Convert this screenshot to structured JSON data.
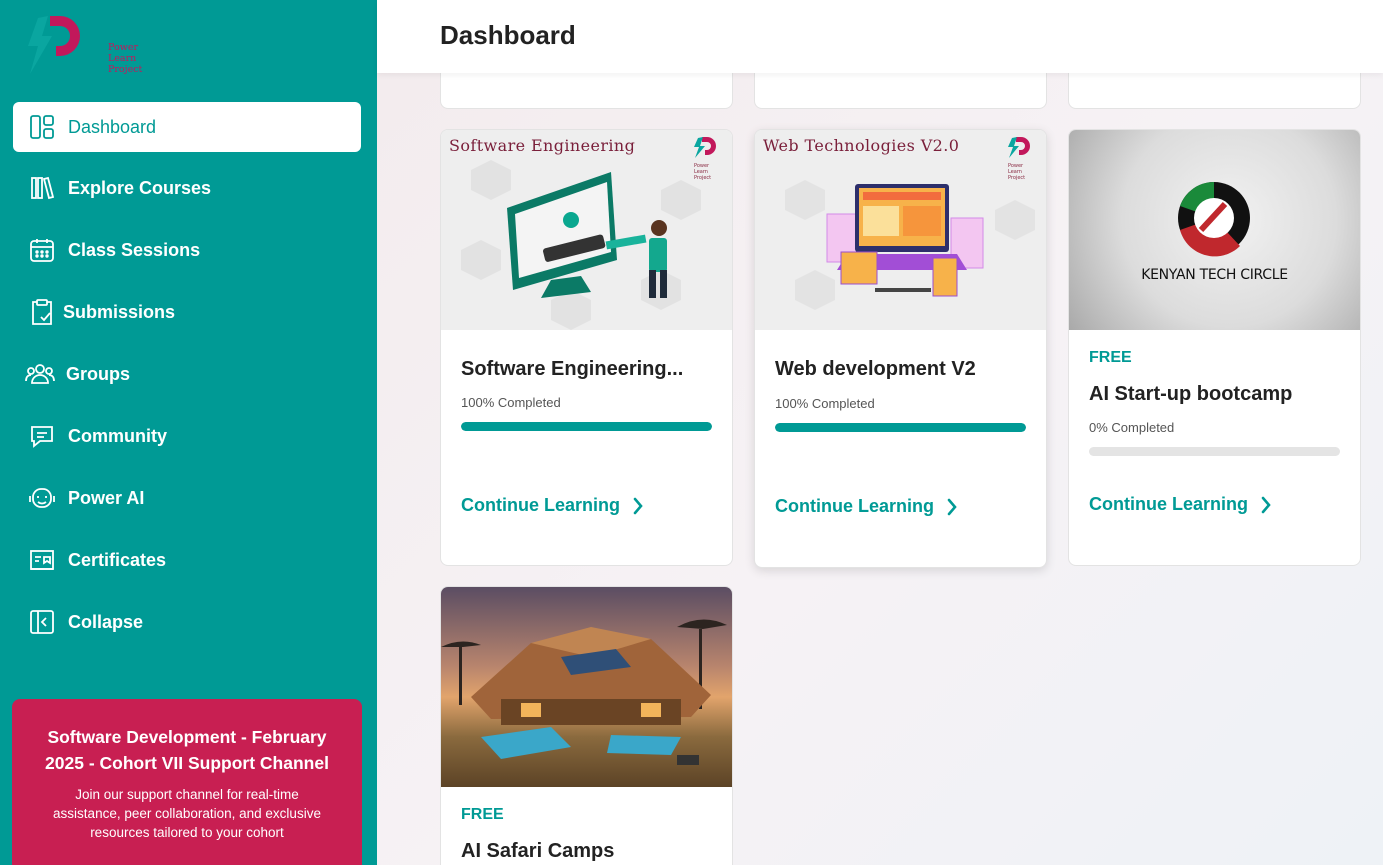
{
  "brand": {
    "logo_line1": "Power",
    "logo_line2": "Learn",
    "logo_line3": "Project"
  },
  "sidebar": {
    "items": [
      {
        "label": "Dashboard",
        "icon": "dashboard-icon",
        "active": true
      },
      {
        "label": "Explore Courses",
        "icon": "books-icon"
      },
      {
        "label": "Class Sessions",
        "icon": "calendar-icon"
      },
      {
        "label": "Submissions",
        "icon": "clipboard-check-icon"
      },
      {
        "label": "Groups",
        "icon": "users-icon"
      },
      {
        "label": "Community",
        "icon": "chat-icon"
      },
      {
        "label": "Power AI",
        "icon": "robot-icon"
      },
      {
        "label": "Certificates",
        "icon": "certificate-icon"
      },
      {
        "label": "Collapse",
        "icon": "collapse-icon"
      }
    ]
  },
  "support": {
    "title": "Software Development - February 2025 - Cohort VII Support Channel",
    "description": "Join our support channel for real-time assistance, peer collaboration, and exclusive resources tailored to your cohort"
  },
  "header": {
    "title": "Dashboard"
  },
  "courses": [
    {
      "title": "Software Engineering...",
      "thumb_title": "Software Engineering",
      "progress_label": "100% Completed",
      "progress": 1.0,
      "cta": "Continue Learning"
    },
    {
      "title": "Web development V2",
      "thumb_title": "Web Technologies V2.0",
      "progress_label": "100% Completed",
      "progress": 1.0,
      "cta": "Continue Learning"
    },
    {
      "badge": "FREE",
      "title": "AI Start-up bootcamp",
      "thumb_title": "KENYAN TECH CIRCLE",
      "progress_label": "0% Completed",
      "progress": 0.0,
      "cta": "Continue Learning"
    },
    {
      "badge": "FREE",
      "title": "AI Safari Camps"
    }
  ],
  "colors": {
    "primary": "#009a95",
    "support_bg": "#c81f52",
    "brand_magenta": "#c2185b"
  }
}
